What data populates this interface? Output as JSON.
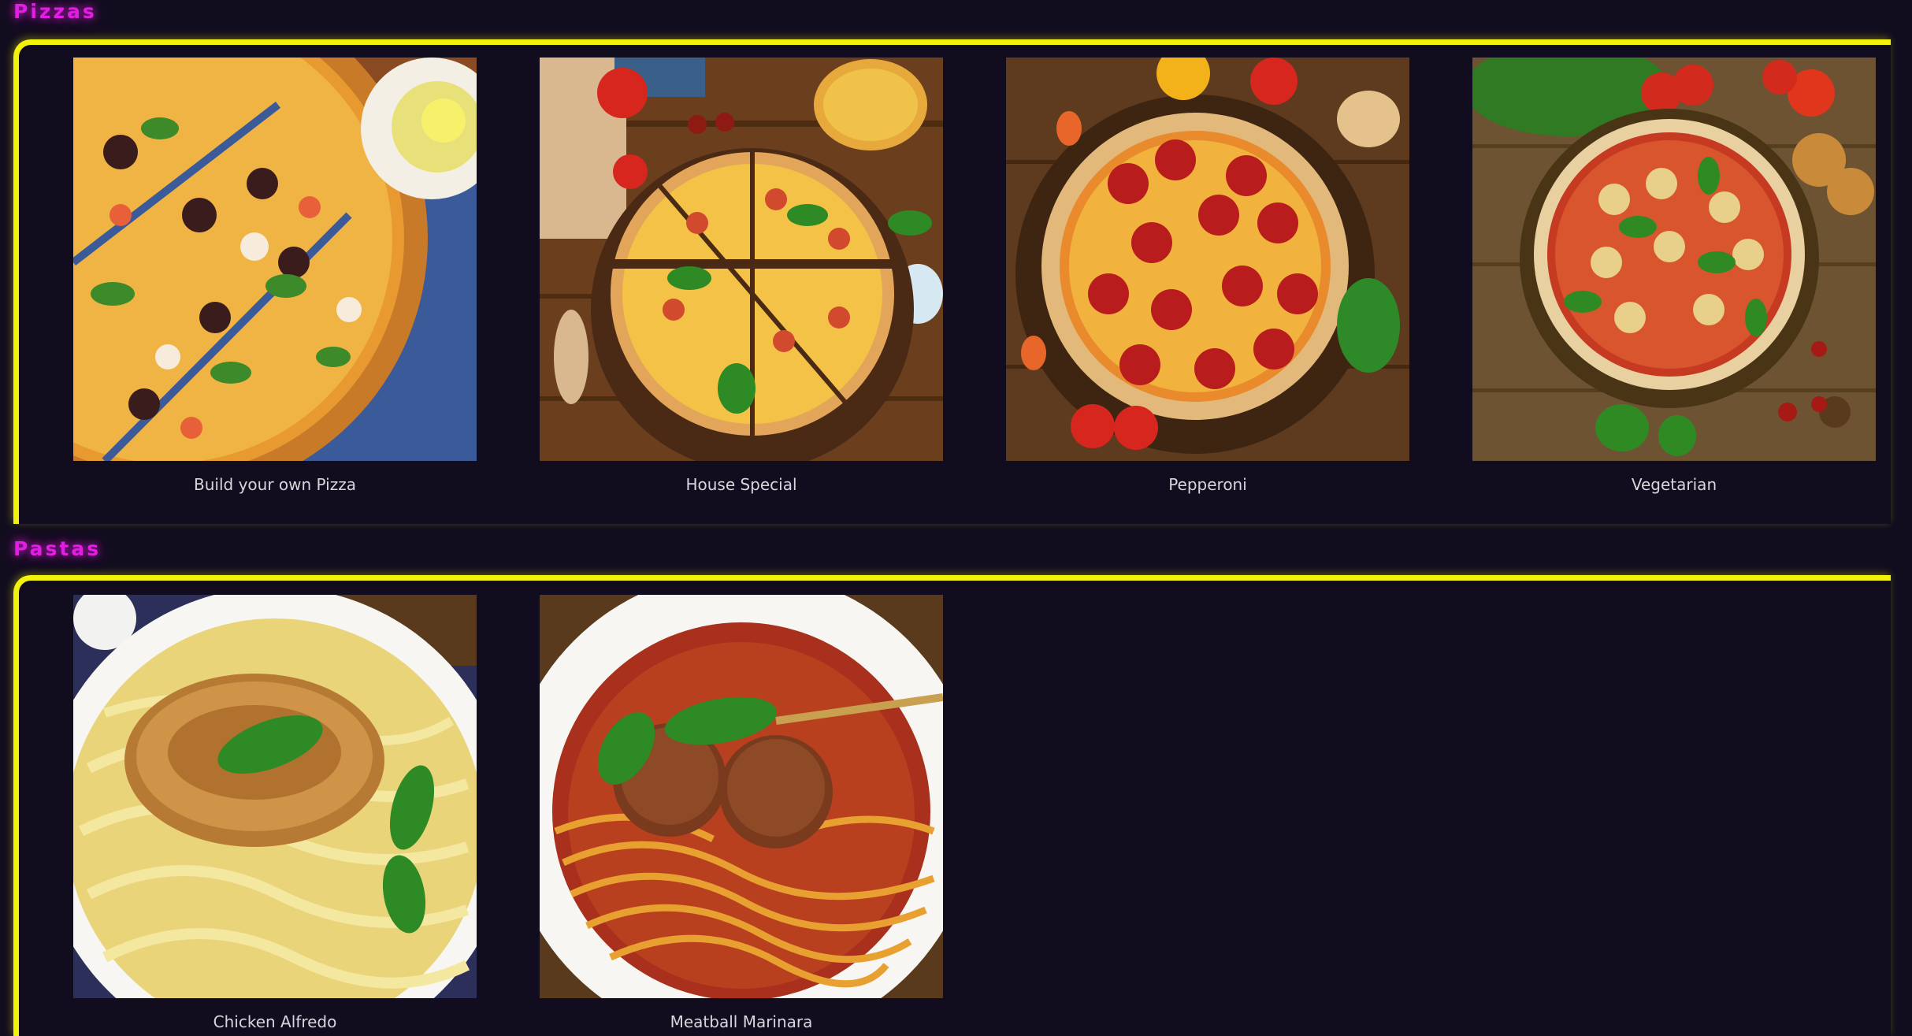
{
  "sections": [
    {
      "title": "Pizzas",
      "items": [
        {
          "label": "Build your own Pizza"
        },
        {
          "label": "House Special"
        },
        {
          "label": "Pepperoni"
        },
        {
          "label": "Vegetarian"
        }
      ]
    },
    {
      "title": "Pastas",
      "items": [
        {
          "label": "Chicken Alfredo"
        },
        {
          "label": "Meatball Marinara"
        }
      ]
    }
  ],
  "colors": {
    "background": "#120d1e",
    "section_title": "#e21ee2",
    "frame": "#f2f20c",
    "label": "#d8d6dc"
  }
}
